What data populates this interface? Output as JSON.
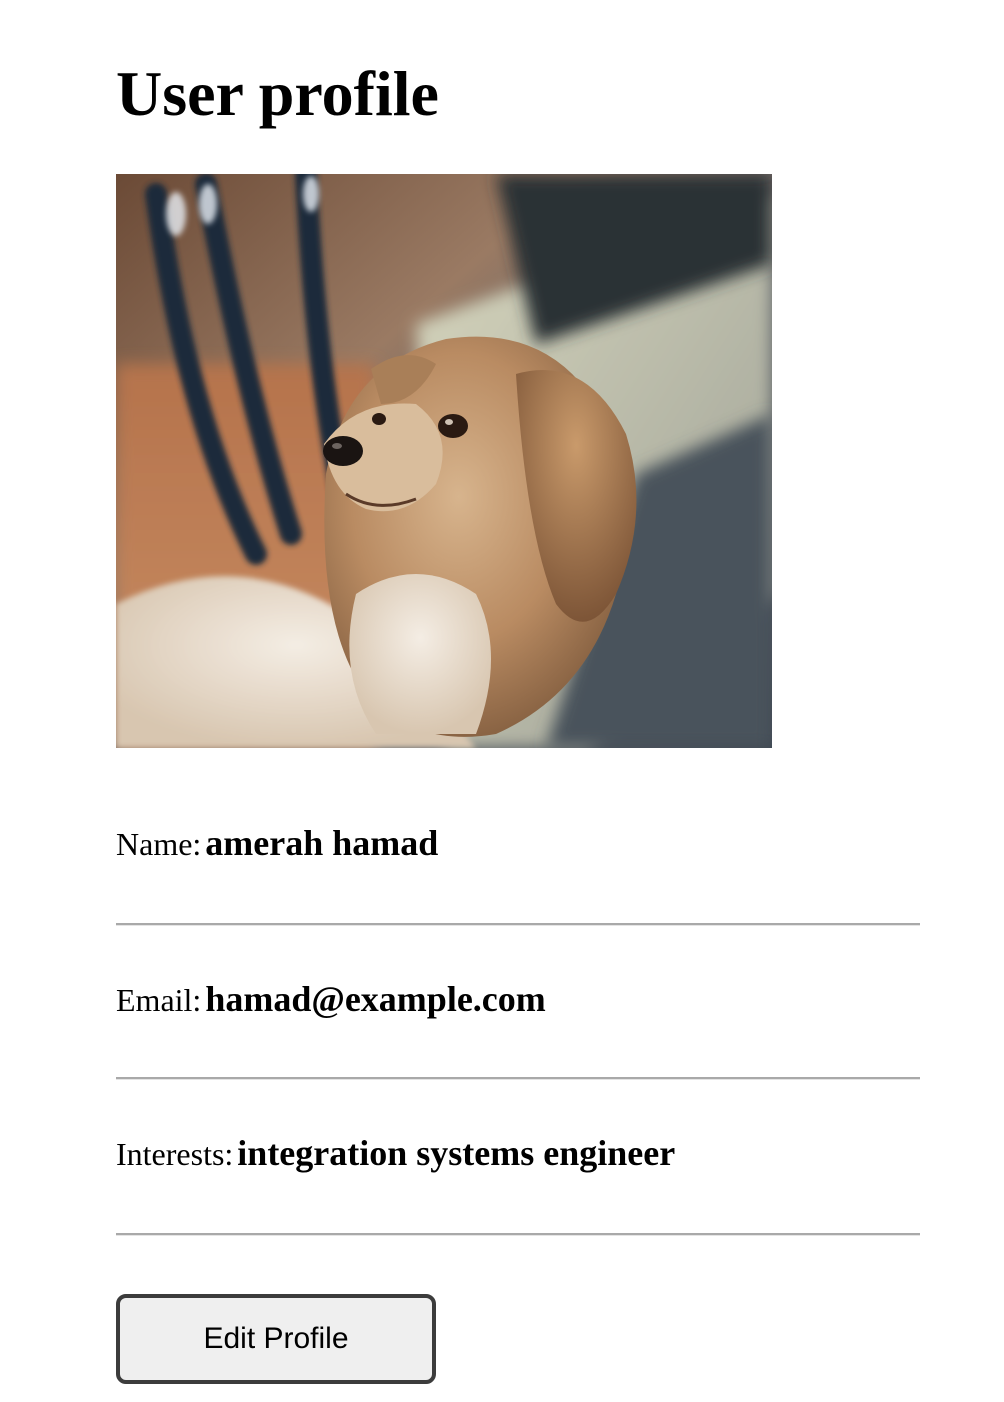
{
  "header": {
    "title": "User profile"
  },
  "profile": {
    "photo_icon": "dog-photo",
    "fields": [
      {
        "label": "Name:",
        "value": "amerah hamad"
      },
      {
        "label": "Email:",
        "value": "hamad@example.com"
      },
      {
        "label": "Interests:",
        "value": "integration systems engineer"
      }
    ]
  },
  "actions": {
    "edit_label": "Edit Profile"
  },
  "colors": {
    "background": "#ffffff",
    "text": "#000000",
    "button_bg": "#efefef",
    "button_border": "#3c3c3c",
    "divider": "#a9a9a9"
  }
}
